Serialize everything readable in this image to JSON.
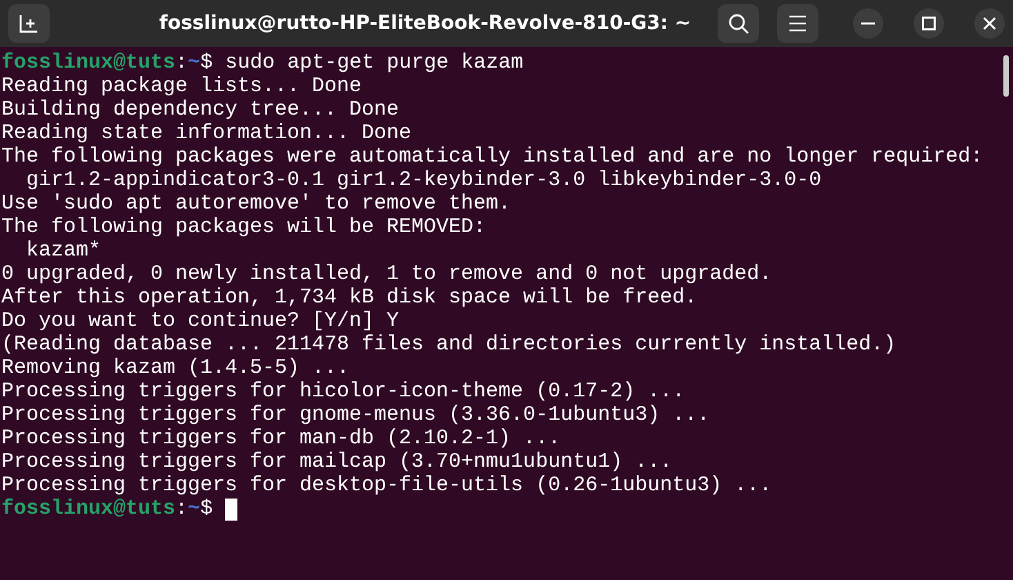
{
  "window": {
    "title": "fosslinux@rutto-HP-EliteBook-Revolve-810-G3: ~"
  },
  "lines": [
    {
      "kind": "prompt",
      "user_host": "fosslinux@tuts",
      "separator": ":",
      "path": "~",
      "symbol": "$",
      "command": " sudo apt-get purge kazam",
      "cursor": false
    },
    {
      "kind": "output",
      "text": "Reading package lists... Done"
    },
    {
      "kind": "output",
      "text": "Building dependency tree... Done"
    },
    {
      "kind": "output",
      "text": "Reading state information... Done"
    },
    {
      "kind": "output",
      "text": "The following packages were automatically installed and are no longer required:"
    },
    {
      "kind": "output",
      "text": "  gir1.2-appindicator3-0.1 gir1.2-keybinder-3.0 libkeybinder-3.0-0"
    },
    {
      "kind": "output",
      "text": "Use 'sudo apt autoremove' to remove them."
    },
    {
      "kind": "output",
      "text": "The following packages will be REMOVED:"
    },
    {
      "kind": "output",
      "text": "  kazam*"
    },
    {
      "kind": "output",
      "text": "0 upgraded, 0 newly installed, 1 to remove and 0 not upgraded."
    },
    {
      "kind": "output",
      "text": "After this operation, 1,734 kB disk space will be freed."
    },
    {
      "kind": "output",
      "text": "Do you want to continue? [Y/n] Y"
    },
    {
      "kind": "output",
      "text": "(Reading database ... 211478 files and directories currently installed.)"
    },
    {
      "kind": "output",
      "text": "Removing kazam (1.4.5-5) ..."
    },
    {
      "kind": "output",
      "text": "Processing triggers for hicolor-icon-theme (0.17-2) ..."
    },
    {
      "kind": "output",
      "text": "Processing triggers for gnome-menus (3.36.0-1ubuntu3) ..."
    },
    {
      "kind": "output",
      "text": "Processing triggers for man-db (2.10.2-1) ..."
    },
    {
      "kind": "output",
      "text": "Processing triggers for mailcap (3.70+nmu1ubuntu1) ..."
    },
    {
      "kind": "output",
      "text": "Processing triggers for desktop-file-utils (0.26-1ubuntu3) ..."
    },
    {
      "kind": "prompt",
      "user_host": "fosslinux@tuts",
      "separator": ":",
      "path": "~",
      "symbol": "$",
      "cursor": true
    }
  ]
}
